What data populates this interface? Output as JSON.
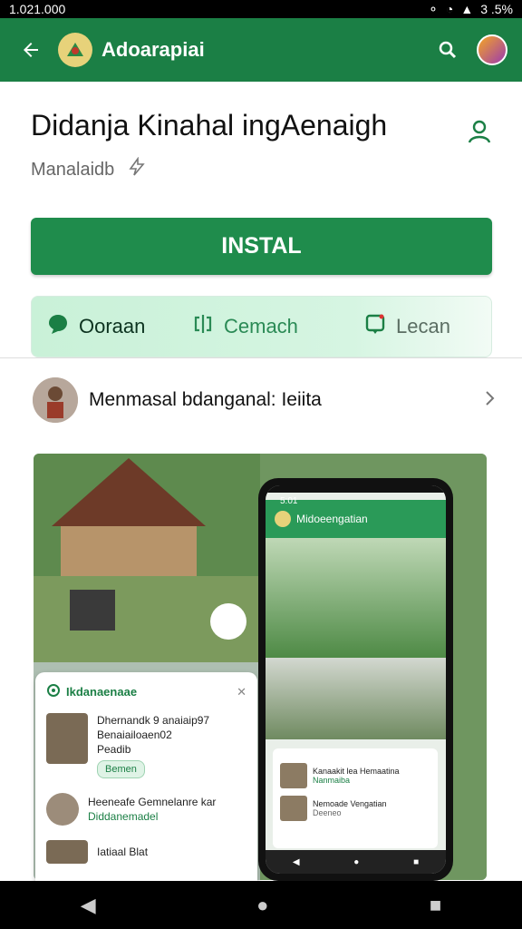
{
  "status": {
    "time": "1.021.000",
    "battery": "3 .5%"
  },
  "appbar": {
    "title": "Adoarapiai",
    "icons": [
      "back-arrow-icon",
      "app-logo-icon",
      "search-icon",
      "avatar"
    ]
  },
  "app": {
    "name": "Didanja Kinahal ingAenaigh",
    "subtitle": "Manalaidb",
    "install_label": "INSTAL"
  },
  "tabs": [
    {
      "label": "Ooraan",
      "icon": "chat-bubble-icon"
    },
    {
      "label": "Cemach",
      "icon": "code-bracket-icon"
    },
    {
      "label": "Lecan",
      "icon": "phone-frame-icon"
    }
  ],
  "developer": {
    "name": "Menmasal bdanganal: Ieiita"
  },
  "card": {
    "header": "Ikdanaenaae",
    "item1_title": "Dhernandk 9 anaiaip97",
    "item1_sub": "Benaiailoaen02",
    "item1_meta": "Peadib",
    "item1_pill": "Bemen",
    "item2_title": "Heeneafe Gemnelanre kar",
    "item2_sub": "Diddanemadel",
    "item3_title": "Iatiaal Blat"
  },
  "phone": {
    "time": "5:01",
    "app_title": "Midoeengatian",
    "row1": "Kanaakit lea Hemaatina",
    "row1_sub": "Nanmaiba",
    "row2": "Nemoade Vengatian",
    "row2_sub": "Deeneo"
  }
}
